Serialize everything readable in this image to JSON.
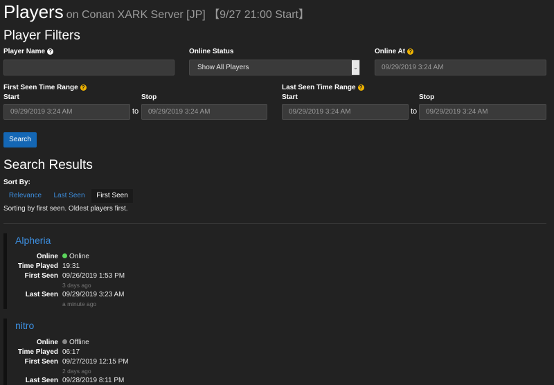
{
  "header": {
    "title": "Players",
    "subtitle": "on Conan XARK Server [JP] 【9/27 21:00 Start】"
  },
  "filters": {
    "heading": "Player Filters",
    "player_name": {
      "label": "Player Name",
      "value": ""
    },
    "online_status": {
      "label": "Online Status",
      "selected": "Show All Players"
    },
    "online_at": {
      "label": "Online At",
      "value": "09/29/2019 3:24 AM"
    },
    "first_seen": {
      "label": "First Seen Time Range",
      "start_label": "Start",
      "stop_label": "Stop",
      "to": "to",
      "start": "09/29/2019 3:24 AM",
      "stop": "09/29/2019 3:24 AM"
    },
    "last_seen": {
      "label": "Last Seen Time Range",
      "start_label": "Start",
      "stop_label": "Stop",
      "to": "to",
      "start": "09/29/2019 3:24 AM",
      "stop": "09/29/2019 3:24 AM"
    },
    "search_button": "Search"
  },
  "results": {
    "heading": "Search Results",
    "sort_by_label": "Sort By:",
    "sort_options": [
      "Relevance",
      "Last Seen",
      "First Seen"
    ],
    "sort_description": "Sorting by first seen. Oldest players first."
  },
  "field_labels": {
    "online": "Online",
    "time_played": "Time Played",
    "first_seen": "First Seen",
    "last_seen": "Last Seen"
  },
  "players": [
    {
      "name": "Alpheria",
      "status": "Online",
      "status_color": "#5cd65c",
      "time_played": "19:31",
      "first_seen": "09/26/2019 1:53 PM",
      "first_seen_ago": "3 days ago",
      "last_seen": "09/29/2019 3:23 AM",
      "last_seen_ago": "a minute ago"
    },
    {
      "name": "nitro",
      "status": "Offline",
      "status_color": "#888888",
      "time_played": "06:17",
      "first_seen": "09/27/2019 12:15 PM",
      "first_seen_ago": "2 days ago",
      "last_seen": "09/28/2019 8:11 PM"
    }
  ],
  "colors": {
    "background": "#222222",
    "accent": "#1467b5",
    "link": "#3d8fe0",
    "help_icon": "#f0b400"
  }
}
